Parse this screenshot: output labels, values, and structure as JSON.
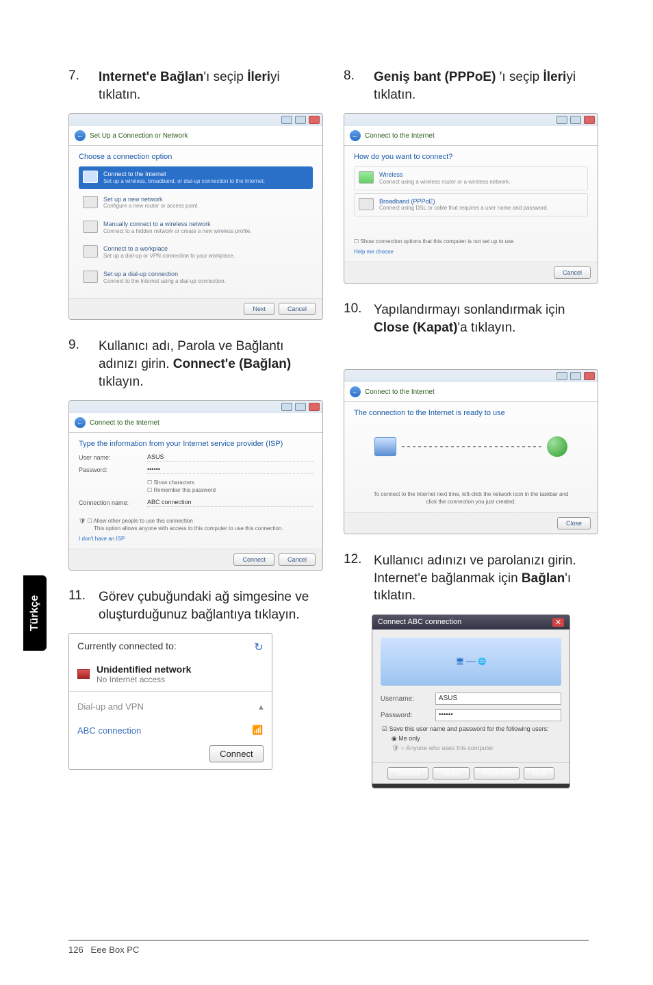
{
  "sidetab": "Türkçe",
  "footer": {
    "page": "126",
    "product": "Eee Box PC"
  },
  "step7": {
    "num": "7.",
    "text_before": "",
    "bold1": "Internet'e Bağlan",
    "text_mid1": "'ı seçip ",
    "bold2": "İleri",
    "text_after": "yi tıklatın."
  },
  "step8": {
    "num": "8.",
    "bold1": "Geniş bant (PPPoE) ",
    "text_mid1": "'ı seçip ",
    "bold2": "İleri",
    "text_after": "yi tıklatın."
  },
  "step9": {
    "num": "9.",
    "text1": "Kullanıcı adı, Parola ve Bağlantı adınızı girin. ",
    "bold1": "Connect'e (Bağlan)",
    "text2": " tıklayın."
  },
  "step10": {
    "num": "10.",
    "text1": "Yapılandırmayı sonlandırmak için ",
    "bold1": "Close (Kapat)",
    "text2": "'a tıklayın."
  },
  "step11": {
    "num": "11.",
    "text1": "Görev çubuğundaki ağ simgesine ve oluşturduğunuz bağlantıya tıklayın."
  },
  "step12": {
    "num": "12.",
    "text1": "Kullanıcı adınızı ve parolanızı girin. Internet'e bağlanmak için ",
    "bold1": "Bağlan",
    "text2": "'ı tıklatın."
  },
  "shot7": {
    "breadcrumb": "Set Up a Connection or Network",
    "heading": "Choose a connection option",
    "opt1": {
      "t": "Connect to the Internet",
      "s": "Set up a wireless, broadband, or dial-up connection to the Internet."
    },
    "opt2": {
      "t": "Set up a new network",
      "s": "Configure a new router or access point."
    },
    "opt3": {
      "t": "Manually connect to a wireless network",
      "s": "Connect to a hidden network or create a new wireless profile."
    },
    "opt4": {
      "t": "Connect to a workplace",
      "s": "Set up a dial-up or VPN connection to your workplace."
    },
    "opt5": {
      "t": "Set up a dial-up connection",
      "s": "Connect to the Internet using a dial-up connection."
    },
    "next": "Next",
    "cancel": "Cancel"
  },
  "shot8": {
    "breadcrumb": "Connect to the Internet",
    "heading": "How do you want to connect?",
    "opt1": {
      "t": "Wireless",
      "s": "Connect using a wireless router or a wireless network."
    },
    "opt2": {
      "t": "Broadband (PPPoE)",
      "s": "Connect using DSL or cable that requires a user name and password."
    },
    "chk": "Show connection options that this computer is not set up to use",
    "help": "Help me choose",
    "cancel": "Cancel"
  },
  "shot9": {
    "breadcrumb": "Connect to the Internet",
    "heading": "Type the information from your Internet service provider (ISP)",
    "user_l": "User name:",
    "user_v": "ASUS",
    "pass_l": "Password:",
    "pass_v": "••••••",
    "chk1": "Show characters",
    "chk2": "Remember this password",
    "conn_l": "Connection name:",
    "conn_v": "ABC connection",
    "allow_t": "Allow other people to use this connection",
    "allow_s": "This option allows anyone with access to this computer to use this connection.",
    "link": "I don't have an ISP",
    "connect": "Connect",
    "cancel": "Cancel"
  },
  "shot10": {
    "breadcrumb": "Connect to the Internet",
    "heading": "The connection to the Internet is ready to use",
    "desc": "To connect to the Internet next time, left-click the network icon in the taskbar and click the connection you just created.",
    "close": "Close"
  },
  "shot11": {
    "title": "Currently connected to:",
    "net": "Unidentified network",
    "netsub": "No Internet access",
    "section": "Dial-up and VPN",
    "abc": "ABC connection",
    "connect": "Connect"
  },
  "shot12": {
    "title": "Connect ABC connection",
    "user_l": "Username:",
    "user_v": "ASUS",
    "pass_l": "Password:",
    "pass_v": "••••••",
    "save": "Save this user name and password for the following users:",
    "me": "Me only",
    "anyone": "Anyone who uses this computer",
    "b1": "Connect",
    "b2": "Cancel",
    "b3": "Properties",
    "b4": "Help"
  }
}
